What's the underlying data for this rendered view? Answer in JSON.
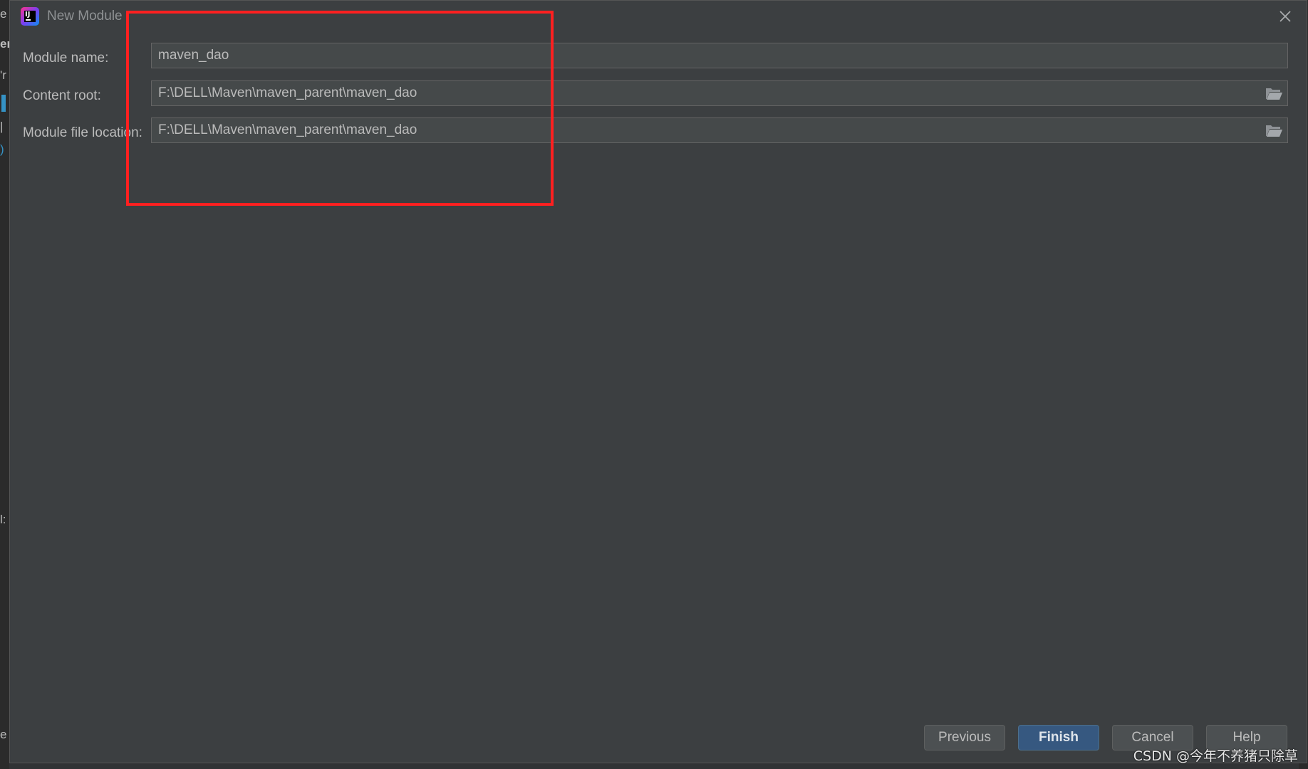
{
  "dialog": {
    "title": "New Module",
    "fields": [
      {
        "label": "Module name:",
        "value": "maven_dao",
        "has_browse": false
      },
      {
        "label": "Content root:",
        "value": "F:\\DELL\\Maven\\maven_parent\\maven_dao",
        "has_browse": true
      },
      {
        "label": "Module file location:",
        "value": "F:\\DELL\\Maven\\maven_parent\\maven_dao",
        "has_browse": true
      }
    ],
    "buttons": {
      "previous": "Previous",
      "finish": "Finish",
      "cancel": "Cancel",
      "help": "Help"
    }
  },
  "background_fragments": [
    "e",
    "er",
    "'r",
    "|",
    ")",
    "l:",
    "e"
  ],
  "watermark": "CSDN @今年不养猪只除草",
  "colors": {
    "dialog_bg": "#3c3f41",
    "field_bg": "#45494a",
    "text": "#bbbbbb",
    "primary_button": "#365880",
    "highlight": "#ff2020"
  },
  "icons": {
    "app": "intellij-idea-icon",
    "close": "close-icon",
    "browse": "folder-icon"
  }
}
